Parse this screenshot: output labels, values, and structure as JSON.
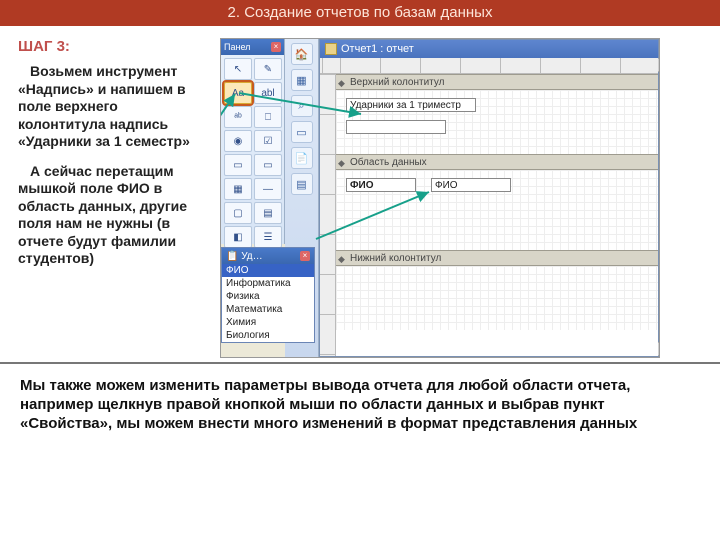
{
  "header": {
    "title": "2. Создание отчетов по базам данных"
  },
  "step": {
    "label": "ШАГ 3:"
  },
  "text": {
    "p1": "Возьмем инструмент «Надпись» и напишем в поле верхнего колонтитула надпись «Ударники за 1 семестр»",
    "p2": "А сейчас перетащим мышкой поле ФИО в область данных, другие поля нам не нужны (в отчете будут фамилии студентов)"
  },
  "footer": {
    "text": "Мы также можем изменить параметры вывода отчета для любой области отчета, например щелкнув правой кнопкой мыши по области данных и выбрав пункт «Свойства», мы можем внести много изменений в формат представления данных"
  },
  "toolbox": {
    "title": "Панел",
    "tools": [
      "↖",
      "✎",
      "Aa",
      "abl",
      "ᵃᵇ",
      "⎕",
      "◉",
      "☑",
      "▭",
      "▭",
      "▦",
      "—",
      "▢",
      "▤",
      "◧",
      "☰",
      "✦",
      "⌄"
    ]
  },
  "fieldbox": {
    "title": "Уд…",
    "items": [
      "ФИО",
      "Информатика",
      "Физика",
      "Математика",
      "Химия",
      "Биология"
    ]
  },
  "doc": {
    "title": "Отчет1 : отчет",
    "sections": {
      "header": "Верхний колонтитул",
      "detail": "Область данных",
      "footer": "Нижний колонтитул"
    },
    "labelText": "Ударники за 1 триместр",
    "fieldCaption": "ФИО",
    "fieldBound": "ФИО"
  }
}
